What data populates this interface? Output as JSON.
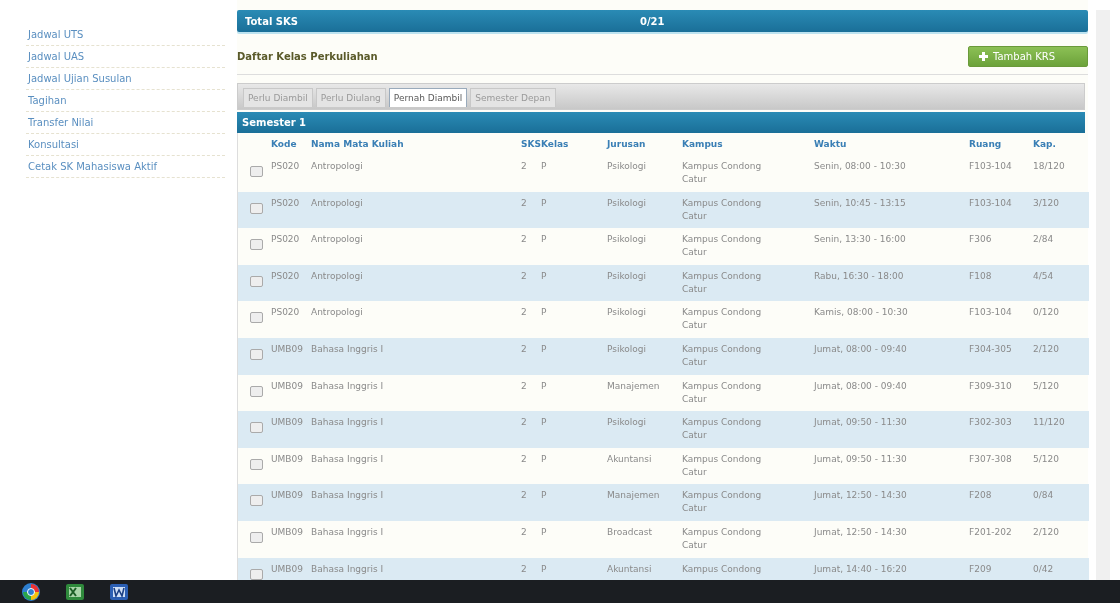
{
  "sidebar": {
    "items": [
      {
        "label": "Jadwal UTS"
      },
      {
        "label": "Jadwal UAS"
      },
      {
        "label": "Jadwal Ujian Susulan"
      },
      {
        "label": "Tagihan"
      },
      {
        "label": "Transfer Nilai"
      },
      {
        "label": "Konsultasi"
      },
      {
        "label": "Cetak SK Mahasiswa Aktif"
      }
    ]
  },
  "total_bar": {
    "label": "Total SKS",
    "value": "0/21"
  },
  "section": {
    "title": "Daftar Kelas Perkuliahan",
    "add_button": "Tambah KRS"
  },
  "tabs": [
    {
      "label": "Perlu Diambil",
      "selected": false
    },
    {
      "label": "Perlu Diulang",
      "selected": false
    },
    {
      "label": "Pernah Diambil",
      "selected": true
    },
    {
      "label": "Semester Depan",
      "selected": false
    }
  ],
  "semester": {
    "title": "Semester 1"
  },
  "table": {
    "columns": [
      "Kode",
      "Nama Mata Kuliah",
      "SKS",
      "Kelas",
      "Jurusan",
      "Kampus",
      "Waktu",
      "Ruang",
      "Kap."
    ],
    "rows": [
      {
        "checked": false,
        "cells": [
          "PS020",
          "Antropologi",
          "2",
          "P",
          "Psikologi",
          "Kampus Condong Catur",
          "Senin, 08:00 - 10:30",
          "F103-104",
          "18/120"
        ]
      },
      {
        "checked": false,
        "cells": [
          "PS020",
          "Antropologi",
          "2",
          "P",
          "Psikologi",
          "Kampus Condong Catur",
          "Senin, 10:45 - 13:15",
          "F103-104",
          "3/120"
        ]
      },
      {
        "checked": false,
        "cells": [
          "PS020",
          "Antropologi",
          "2",
          "P",
          "Psikologi",
          "Kampus Condong Catur",
          "Senin, 13:30 - 16:00",
          "F306",
          "2/84"
        ]
      },
      {
        "checked": false,
        "cells": [
          "PS020",
          "Antropologi",
          "2",
          "P",
          "Psikologi",
          "Kampus Condong Catur",
          "Rabu, 16:30 - 18:00",
          "F108",
          "4/54"
        ]
      },
      {
        "checked": false,
        "cells": [
          "PS020",
          "Antropologi",
          "2",
          "P",
          "Psikologi",
          "Kampus Condong Catur",
          "Kamis, 08:00 - 10:30",
          "F103-104",
          "0/120"
        ]
      },
      {
        "checked": false,
        "cells": [
          "UMB09",
          "Bahasa Inggris I",
          "2",
          "P",
          "Psikologi",
          "Kampus Condong Catur",
          "Jumat, 08:00 - 09:40",
          "F304-305",
          "2/120"
        ]
      },
      {
        "checked": false,
        "cells": [
          "UMB09",
          "Bahasa Inggris I",
          "2",
          "P",
          "Manajemen",
          "Kampus Condong Catur",
          "Jumat, 08:00 - 09:40",
          "F309-310",
          "5/120"
        ]
      },
      {
        "checked": false,
        "cells": [
          "UMB09",
          "Bahasa Inggris I",
          "2",
          "P",
          "Psikologi",
          "Kampus Condong Catur",
          "Jumat, 09:50 - 11:30",
          "F302-303",
          "11/120"
        ]
      },
      {
        "checked": false,
        "cells": [
          "UMB09",
          "Bahasa Inggris I",
          "2",
          "P",
          "Akuntansi",
          "Kampus Condong Catur",
          "Jumat, 09:50 - 11:30",
          "F307-308",
          "5/120"
        ]
      },
      {
        "checked": false,
        "cells": [
          "UMB09",
          "Bahasa Inggris I",
          "2",
          "P",
          "Manajemen",
          "Kampus Condong Catur",
          "Jumat, 12:50 - 14:30",
          "F208",
          "0/84"
        ]
      },
      {
        "checked": false,
        "cells": [
          "UMB09",
          "Bahasa Inggris I",
          "2",
          "P",
          "Broadcast",
          "Kampus Condong Catur",
          "Jumat, 12:50 - 14:30",
          "F201-202",
          "2/120"
        ]
      },
      {
        "checked": false,
        "cells": [
          "UMB09",
          "Bahasa Inggris I",
          "2",
          "P",
          "Akuntansi",
          "Kampus Condong",
          "Jumat, 14:40 - 16:20",
          "F209",
          "0/42"
        ]
      }
    ]
  }
}
